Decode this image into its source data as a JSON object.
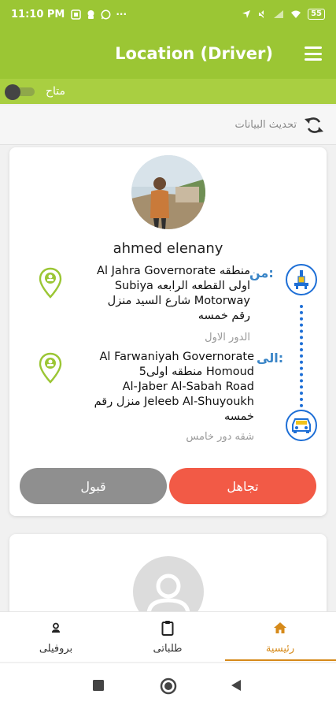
{
  "status_bar": {
    "time": "11:10 PM",
    "battery": "55",
    "more": "···"
  },
  "app_bar": {
    "title": "Location (Driver)"
  },
  "availability": {
    "label": "متاح",
    "enabled": false
  },
  "refresh": {
    "label": "تحديث البيانات"
  },
  "request": {
    "driver_name": "ahmed elenany",
    "from": {
      "label": "من:",
      "address_lines": [
        "Al Jahra Governorate منطقه",
        "Subiya اولى القطعه الرابعه",
        "شارع السيد منزل Motorway",
        "رقم خمسه"
      ],
      "floor": "الدور الاول"
    },
    "to": {
      "label": "الى:",
      "address_lines": [
        "Al Farwaniyah Governorate",
        "5منطقه اولى Homoud",
        "Al-Jaber Al-Sabah Road",
        "منزل رقم Jeleeb Al-Shuyoukh",
        "خمسه"
      ],
      "floor": "شقه دور خامس"
    },
    "ignore_label": "تجاهل",
    "accept_label": "قبول"
  },
  "bottom_nav": {
    "items": [
      {
        "label": "بروفيلى",
        "icon": "person-icon"
      },
      {
        "label": "طلباتى",
        "icon": "clipboard-icon"
      },
      {
        "label": "رئيسية",
        "icon": "home-icon"
      }
    ],
    "active_index": 2
  },
  "colors": {
    "brand_green": "#9bc634",
    "ignore_red": "#f25a46",
    "accept_gray": "#8f8f8f",
    "route_blue": "#1e6fd6",
    "active_orange": "#d68a1a"
  }
}
